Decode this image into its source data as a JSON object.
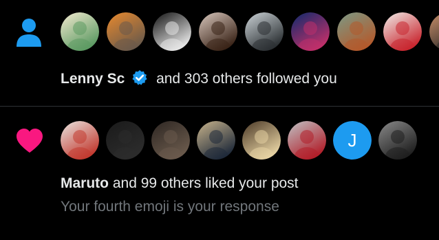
{
  "follow_notification": {
    "icon": "person-icon",
    "icon_color": "#1d9bf0",
    "actor_name": "Lenny Sc",
    "verified": true,
    "verified_color": "#1d9bf0",
    "action_text": "and 303 others followed you",
    "avatars": [
      {
        "name": "avatar-cartoon-dragon",
        "colors": [
          "#f4ead0",
          "#5c9a63"
        ]
      },
      {
        "name": "avatar-ape-nft",
        "colors": [
          "#e98a2e",
          "#6b5a4a"
        ]
      },
      {
        "name": "avatar-doodle-sheep",
        "colors": [
          "#111111",
          "#e6e6e6"
        ]
      },
      {
        "name": "avatar-woman-portrait",
        "colors": [
          "#d8c7bd",
          "#3a2418"
        ]
      },
      {
        "name": "avatar-person-standing",
        "colors": [
          "#cdd4d8",
          "#2b3033"
        ]
      },
      {
        "name": "avatar-blue-figure",
        "colors": [
          "#0d2a6b",
          "#c0306a"
        ]
      },
      {
        "name": "avatar-ape-green",
        "colors": [
          "#7b9a86",
          "#b35a2c"
        ]
      },
      {
        "name": "avatar-red-cap-girl",
        "colors": [
          "#f0eeea",
          "#c9262f"
        ]
      },
      {
        "name": "avatar-partial",
        "colors": [
          "#c98f6a",
          "#2e2a28"
        ]
      }
    ]
  },
  "like_notification": {
    "icon": "heart-icon",
    "icon_color": "#f91880",
    "actor_name": "Maruto",
    "action_text": "and 99 others liked your post",
    "post_preview": "Your fourth emoji is your response",
    "avatars": [
      {
        "name": "avatar-anime-character",
        "colors": [
          "#e9e6e2",
          "#c23a30"
        ]
      },
      {
        "name": "avatar-dark-hooded",
        "colors": [
          "#1a1a1a",
          "#2c2c2c"
        ]
      },
      {
        "name": "avatar-dark-photo",
        "colors": [
          "#2d2622",
          "#6a5a4c"
        ]
      },
      {
        "name": "avatar-man-in-suit",
        "colors": [
          "#c9b48c",
          "#1f2a3a"
        ]
      },
      {
        "name": "avatar-smiling-man",
        "colors": [
          "#4a3826",
          "#e6d2a2"
        ]
      },
      {
        "name": "avatar-football-player",
        "colors": [
          "#bfc3c6",
          "#b21f2a"
        ]
      },
      {
        "name": "avatar-letter-j",
        "initial": "J",
        "colors": [
          "#1d9bf0",
          "#1d9bf0"
        ]
      },
      {
        "name": "avatar-bw-photo",
        "colors": [
          "#8a8a8a",
          "#1f1f1f"
        ]
      }
    ]
  }
}
